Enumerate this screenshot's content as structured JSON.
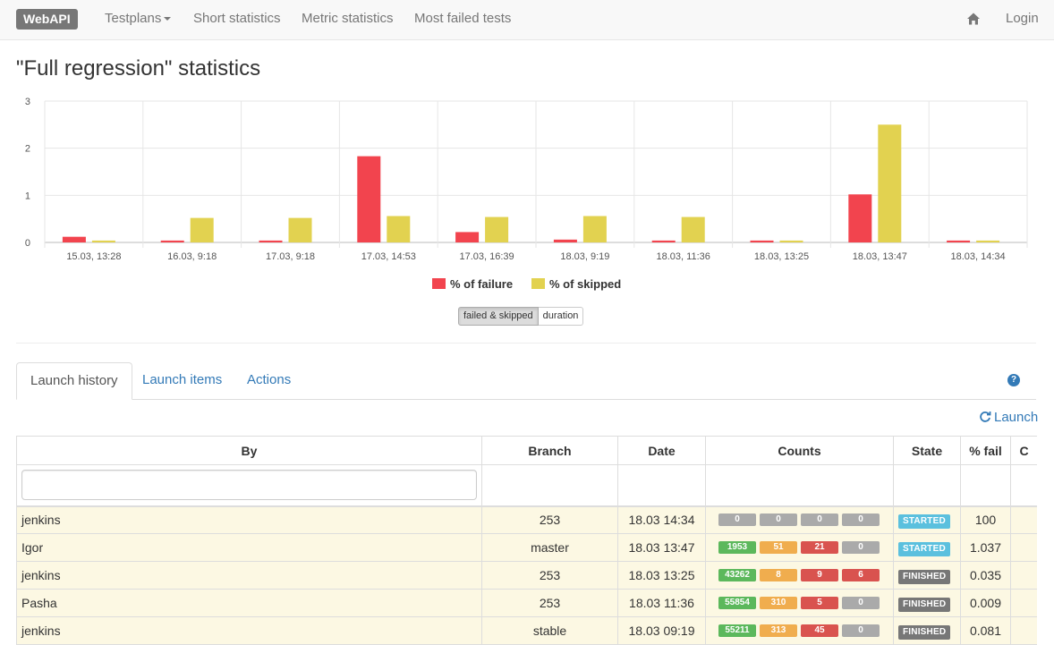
{
  "navbar": {
    "brand": "WebAPI",
    "items": [
      "Testplans",
      "Short statistics",
      "Metric statistics",
      "Most failed tests"
    ],
    "login": "Login"
  },
  "page_title": "\"Full regression\" statistics",
  "chart_data": {
    "type": "bar",
    "categories": [
      "15.03, 13:28",
      "16.03, 9:18",
      "17.03, 9:18",
      "17.03, 14:53",
      "17.03, 16:39",
      "18.03, 9:19",
      "18.03, 11:36",
      "18.03, 13:25",
      "18.03, 13:47",
      "18.03, 14:34"
    ],
    "series": [
      {
        "name": "% of failure",
        "color": "#f2444e",
        "values": [
          0.12,
          0.04,
          0.04,
          1.83,
          0.22,
          0.06,
          0.04,
          0.04,
          1.02,
          0.04
        ]
      },
      {
        "name": "% of skipped",
        "color": "#e2d250",
        "values": [
          0.04,
          0.52,
          0.52,
          0.56,
          0.54,
          0.56,
          0.54,
          0.04,
          2.5,
          0.04
        ]
      }
    ],
    "ylim": [
      0,
      3
    ],
    "yticks": [
      "0",
      "1",
      "2",
      "3"
    ],
    "grid": true,
    "legend_position": "bottom"
  },
  "toggle": {
    "active": "failed & skipped",
    "other": "duration"
  },
  "tabs": [
    "Launch history",
    "Launch items",
    "Actions"
  ],
  "help": "?",
  "launch_label": "Launch",
  "table": {
    "headers": [
      "By",
      "Branch",
      "Date",
      "Counts",
      "State",
      "% fail",
      "C"
    ],
    "filter_value": "",
    "rows": [
      {
        "by": "jenkins",
        "branch": "253",
        "date": "18.03 14:34",
        "counts": [
          "0",
          "0",
          "0",
          "0"
        ],
        "count_colors": [
          "#aaaaaa",
          "#aaaaaa",
          "#aaaaaa",
          "#aaaaaa"
        ],
        "state": "STARTED",
        "state_color": "#5bc0de",
        "fail": "100"
      },
      {
        "by": "Igor",
        "branch": "master",
        "date": "18.03 13:47",
        "counts": [
          "1953",
          "51",
          "21",
          "0"
        ],
        "count_colors": [
          "#5cb85c",
          "#f0ad4e",
          "#d9534f",
          "#aaaaaa"
        ],
        "state": "STARTED",
        "state_color": "#5bc0de",
        "fail": "1.037"
      },
      {
        "by": "jenkins",
        "branch": "253",
        "date": "18.03 13:25",
        "counts": [
          "43262",
          "8",
          "9",
          "6"
        ],
        "count_colors": [
          "#5cb85c",
          "#f0ad4e",
          "#d9534f",
          "#d9534f"
        ],
        "state": "FINISHED",
        "state_color": "#777777",
        "fail": "0.035"
      },
      {
        "by": "Pasha",
        "branch": "253",
        "date": "18.03 11:36",
        "counts": [
          "55854",
          "310",
          "5",
          "0"
        ],
        "count_colors": [
          "#5cb85c",
          "#f0ad4e",
          "#d9534f",
          "#aaaaaa"
        ],
        "state": "FINISHED",
        "state_color": "#777777",
        "fail": "0.009"
      },
      {
        "by": "jenkins",
        "branch": "stable",
        "date": "18.03 09:19",
        "counts": [
          "55211",
          "313",
          "45",
          "0"
        ],
        "count_colors": [
          "#5cb85c",
          "#f0ad4e",
          "#d9534f",
          "#aaaaaa"
        ],
        "state": "FINISHED",
        "state_color": "#777777",
        "fail": "0.081"
      }
    ]
  }
}
